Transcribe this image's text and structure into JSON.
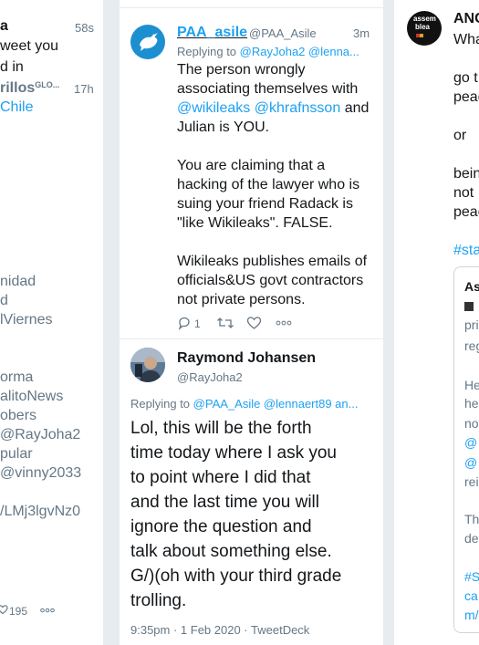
{
  "col1": {
    "rows": [
      {
        "text": "a"
      },
      {
        "text": "58s"
      },
      {
        "text": "weet you"
      },
      {
        "text": "d in"
      },
      {
        "text": "rillos"
      },
      {
        "text": "GLO..."
      },
      {
        "text": "17h"
      },
      {
        "text": "Chile"
      },
      {
        "text": "nidad"
      },
      {
        "text": "d"
      },
      {
        "text": "lViernes"
      },
      {
        "text": "orma"
      },
      {
        "text": "alitoNews"
      },
      {
        "text": "obers"
      },
      {
        "text": "@RayJoha2"
      },
      {
        "text": "pular"
      },
      {
        "text": "@vinny2033"
      },
      {
        "text": "/LMj3lgvNz0"
      }
    ],
    "like_count": "195"
  },
  "tweet1": {
    "display_name": "PAA_asile",
    "handle": "@PAA_Asile",
    "time": "3m",
    "replying_label": "Replying to",
    "replying_to": "@RayJoha2 @lenna...",
    "line1": "The person wrongly",
    "line2": "associating themselves with",
    "mention1": "@wikileaks",
    "mention2": "@khrafnsson",
    "and_word": "and",
    "line4": "Julian is YOU.",
    "para2": [
      "You are claiming that a",
      "hacking of the lawyer who is",
      "suing your friend Radack is",
      "\"like Wikileaks\".  FALSE."
    ],
    "para3": [
      "Wikileaks publishes emails of",
      "officials&US govt contractors",
      "not private persons."
    ],
    "reply_count": "1"
  },
  "tweet2": {
    "display_name": "Raymond Johansen",
    "handle": "@RayJoha2",
    "replying_label": "Replying to",
    "replying_to": "@PAA_Asile @lennaert89 an...",
    "body": [
      "Lol, this will be the forth",
      "time today where I ask you",
      "to point where I did that",
      "and the last time you will",
      "ignore the question and",
      "talk about something else.",
      "G/)(oh with your third grade",
      "trolling."
    ],
    "timestamp": "9:35pm · 1 Feb 2020 · TweetDeck"
  },
  "col3": {
    "name": "ANC",
    "avatar_text1": "assem",
    "avatar_text2": "blea",
    "lines": [
      "Wha",
      "go t",
      "peac",
      "or",
      "bein",
      "not",
      "peac"
    ],
    "hashtag": "#sta",
    "quote": {
      "name": "As",
      "lines1": [
        "pri",
        "reg"
      ],
      "lines2": [
        "He",
        "he",
        "no"
      ],
      "mentions": [
        "@",
        "@"
      ],
      "line_rei": "rei",
      "lines3": [
        "Th",
        "de"
      ],
      "links": [
        "#S",
        "ca",
        "m/"
      ]
    }
  },
  "colors": {
    "accent": "#1da1f2",
    "text": "#14171a",
    "secondary": "#657786",
    "background": "#e6ecf0"
  }
}
